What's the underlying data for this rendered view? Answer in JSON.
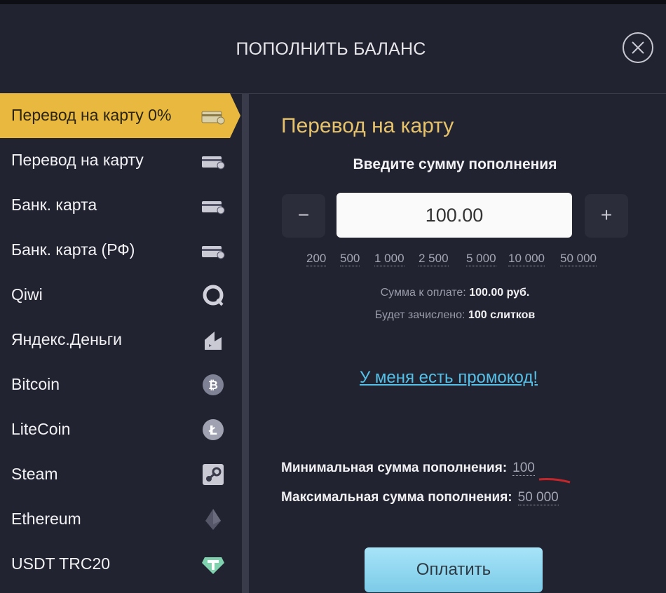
{
  "modal": {
    "title": "ПОПОЛНИТЬ БАЛАНС",
    "close_icon": "close-icon"
  },
  "sidebar": {
    "items": [
      {
        "label": "Перевод на карту 0%",
        "icon": "card-transfer-icon",
        "active": true
      },
      {
        "label": "Перевод на карту",
        "icon": "card-transfer-icon"
      },
      {
        "label": "Банк. карта",
        "icon": "bank-card-icon"
      },
      {
        "label": "Банк. карта (РФ)",
        "icon": "bank-card-icon"
      },
      {
        "label": "Qiwi",
        "icon": "qiwi-icon"
      },
      {
        "label": "Яндекс.Деньги",
        "icon": "yandex-money-icon"
      },
      {
        "label": "Bitcoin",
        "icon": "bitcoin-icon"
      },
      {
        "label": "LiteCoin",
        "icon": "litecoin-icon"
      },
      {
        "label": "Steam",
        "icon": "steam-icon"
      },
      {
        "label": "Ethereum",
        "icon": "ethereum-icon"
      },
      {
        "label": "USDT TRC20",
        "icon": "tether-icon"
      }
    ]
  },
  "main": {
    "section_title": "Перевод на карту",
    "enter_label": "Введите сумму пополнения",
    "minus_label": "−",
    "plus_label": "+",
    "amount_value": "100.00",
    "presets": [
      "200",
      "500",
      "1 000",
      "2 500",
      "5 000",
      "10 000",
      "50 000"
    ],
    "pay_sum_label": "Сумма к оплате:",
    "pay_sum_value": "100.00 руб.",
    "credit_label": "Будет зачислено:",
    "credit_value": "100 слитков",
    "promo_link": "У меня есть промокод!",
    "min_label": "Минимальная сумма пополнения:",
    "min_value": "100",
    "max_label": "Максимальная сумма пополнения:",
    "max_value": "50 000",
    "pay_button": "Оплатить"
  },
  "colors": {
    "background": "#222330",
    "active_item": "#e8b83f",
    "section_title": "#e6c26a",
    "link": "#55c0e8",
    "pay_button": "#8fd6ef"
  }
}
